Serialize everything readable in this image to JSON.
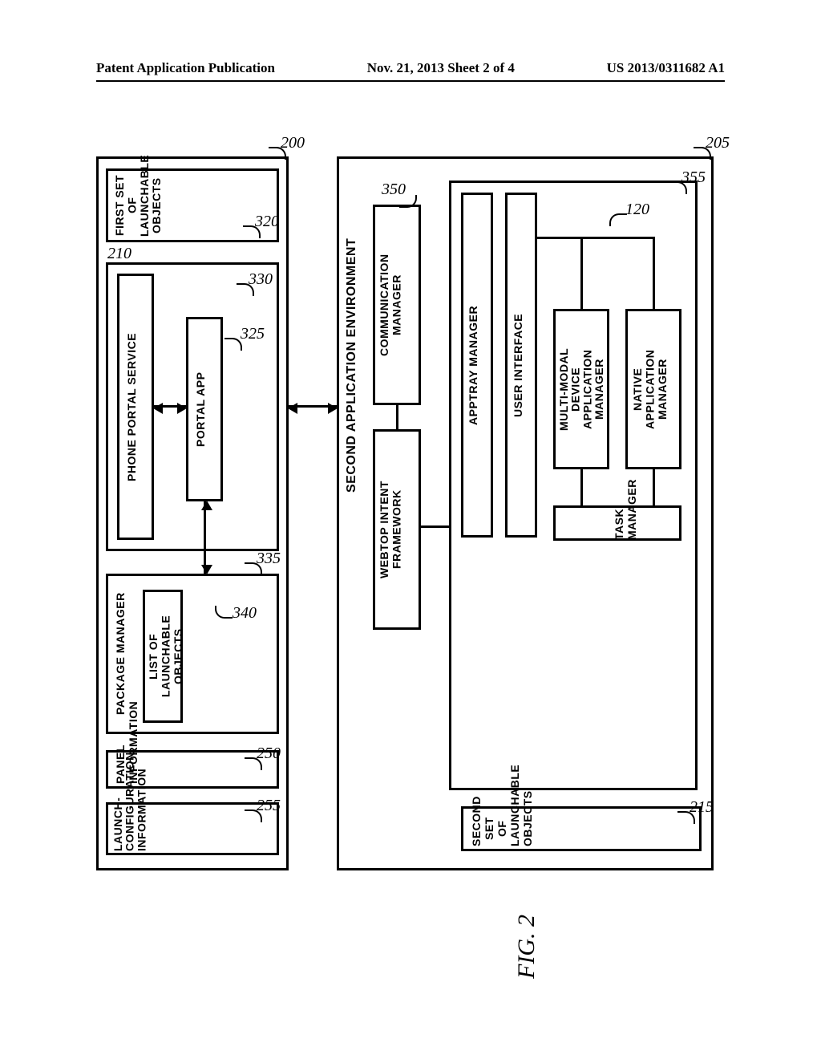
{
  "header": {
    "left": "Patent Application Publication",
    "center": "Nov. 21, 2013  Sheet 2 of 4",
    "right": "US 2013/0311682 A1"
  },
  "figure_label": "FIG. 2",
  "env1": {
    "first_set": "FIRST SET OF\nLAUNCHABLE OBJECTS",
    "phone_portal": "PHONE PORTAL SERVICE",
    "portal_app": "PORTAL APP",
    "package_mgr": "PACKAGE MANAGER",
    "list_launchable": "LIST OF\nLAUNCHABLE OBJECTS",
    "panel_info": "PANEL INFORMATION",
    "launch_cfg": "LAUNCH-CONFIGURATION\nINFORMATION"
  },
  "env2": {
    "title": "SECOND APPLICATION ENVIRONMENT",
    "comm_mgr": "COMMUNICATION\nMANAGER",
    "webtop": "WEBTOP INTENT\nFRAMEWORK",
    "apptray": "APPTRAY MANAGER",
    "ui": "USER INTERFACE",
    "mm_app_mgr": "MULTI-MODAL\nDEVICE\nAPPLICATION\nMANAGER",
    "native_app_mgr": "NATIVE\nAPPLICATION\nMANAGER",
    "task_mgr": "TASK MANAGER",
    "second_set": "SECOND SET OF LAUNCHABLE OBJECTS"
  },
  "nums": {
    "n200": "200",
    "n205": "205",
    "n210": "210",
    "n215": "215",
    "n250": "250",
    "n255": "255",
    "n320": "320",
    "n325": "325",
    "n330": "330",
    "n335": "335",
    "n340": "340",
    "n350": "350",
    "n355": "355",
    "n120": "120"
  }
}
